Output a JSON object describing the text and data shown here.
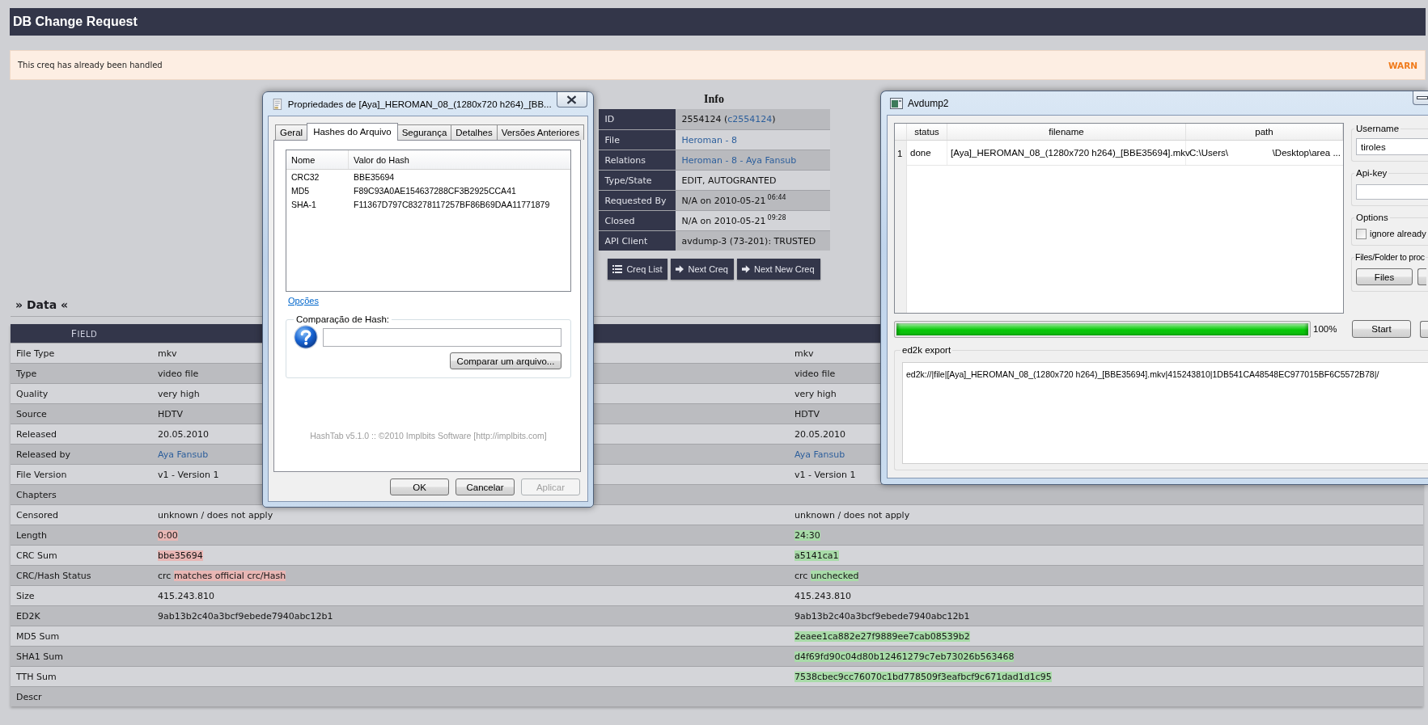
{
  "header": {
    "title": "DB Change Request"
  },
  "alert": {
    "message": "This creq has already been handled",
    "badge": "WARN"
  },
  "hash_dialog": {
    "title": "Propriedades de [Aya]_HEROMAN_08_(1280x720 h264)_[BB...",
    "tabs": [
      {
        "label": "Geral",
        "selected": false
      },
      {
        "label": "Hashes do Arquivo",
        "selected": true
      },
      {
        "label": "Segurança",
        "selected": false
      },
      {
        "label": "Detalhes",
        "selected": false
      },
      {
        "label": "Versões Anteriores",
        "selected": false
      }
    ],
    "hash_list": {
      "columns": [
        {
          "label": "Nome"
        },
        {
          "label": "Valor do Hash"
        }
      ],
      "rows": [
        {
          "name": "CRC32",
          "value": "BBE35694"
        },
        {
          "name": "MD5",
          "value": "F89C93A0AE154637288CF3B2925CCA41"
        },
        {
          "name": "SHA-1",
          "value": "F11367D797C83278117257BF86B69DAA11771879"
        }
      ]
    },
    "options_link": "Opções",
    "compare": {
      "legend": "Comparação de Hash:",
      "button": "Comparar um arquivo..."
    },
    "footer": "HashTab v5.1.0 :: ©2010 Implbits Software [http://implbits.com]",
    "buttons": [
      {
        "label": "OK",
        "disabled": false
      },
      {
        "label": "Cancelar",
        "disabled": false
      },
      {
        "label": "Aplicar",
        "disabled": true
      }
    ]
  },
  "info": {
    "title": "Info",
    "rows": [
      {
        "label": "ID",
        "value": [
          {
            "text": "2554124 (",
            "link": false
          },
          {
            "text": "c2554124",
            "link": true
          },
          {
            "text": ")",
            "link": false
          }
        ]
      },
      {
        "label": "File",
        "value": [
          {
            "text": "Heroman - 8",
            "link": true
          }
        ]
      },
      {
        "label": "Relations",
        "value": [
          {
            "text": "Heroman - 8 - Aya Fansub",
            "link": true
          }
        ]
      },
      {
        "label": "Type/State",
        "value": [
          {
            "text": "EDIT, AUTOGRANTED",
            "link": false
          }
        ]
      },
      {
        "label": "Requested By",
        "value": [
          {
            "text": "N/A on 2010-05-21$^{06:44}$",
            "link": false
          }
        ]
      },
      {
        "label": "Closed",
        "value": [
          {
            "text": "N/A on 2010-05-21$^{09:28}$",
            "link": false
          }
        ]
      },
      {
        "label": "API Client",
        "value": [
          {
            "text": "avdump-3 (73-201): TRUSTED",
            "link": false
          }
        ]
      }
    ],
    "buttons": [
      {
        "label": "Creq List",
        "kind": "list"
      },
      {
        "label": "Next Creq",
        "kind": "next"
      },
      {
        "label": "Next New Creq",
        "kind": "next"
      }
    ]
  },
  "avdump": {
    "title": "Avdump2",
    "table": {
      "columns": [
        {
          "label": "status"
        },
        {
          "label": "filename"
        },
        {
          "label": "path"
        }
      ],
      "rows": [
        {
          "number": "1",
          "status": "done",
          "filename": "[Aya]_HEROMAN_08_(1280x720 h264)_[BBE35694].mkv",
          "path": [
            "C:\\Users\\",
            "\\Desktop\\area ..."
          ]
        }
      ]
    },
    "username": {
      "label": "Username",
      "value": "tiroles"
    },
    "api_key": {
      "label": "Api-key"
    },
    "options": {
      "label": "Options",
      "checkboxes": [
        {
          "label": "ignore already",
          "checked": false
        }
      ]
    },
    "files": {
      "label": "Files/Folder to proc",
      "button": "Files"
    },
    "progress": {
      "level": 1,
      "reading": "100%"
    },
    "start_button": "Start",
    "ed2k_export": {
      "label": "ed2k export",
      "value": "ed2k://|file|[Aya]_HEROMAN_08_(1280x720 h264)_[BBE35694].mkv|415243810|1DB541CA48548EC977015BF6C5572B78|/"
    }
  },
  "data": {
    "heading": "» Data «",
    "columns": [
      {
        "label": "FIELD"
      }
    ],
    "rows": [
      {
        "field": "File Type",
        "column_2": [
          {
            "text": "mkv",
            "highlighted": false,
            "link": false
          }
        ],
        "column_3": [
          {
            "text": "mkv",
            "highlighted": false,
            "link": false
          }
        ]
      },
      {
        "field": "Type",
        "column_2": [
          {
            "text": "video file",
            "highlighted": false,
            "link": false
          }
        ],
        "column_3": [
          {
            "text": "video file",
            "highlighted": false,
            "link": false
          }
        ]
      },
      {
        "field": "Quality",
        "column_2": [
          {
            "text": "very high",
            "highlighted": false,
            "link": false
          }
        ],
        "column_3": [
          {
            "text": "very high",
            "highlighted": false,
            "link": false
          }
        ]
      },
      {
        "field": "Source",
        "column_2": [
          {
            "text": "HDTV",
            "highlighted": false,
            "link": false
          }
        ],
        "column_3": [
          {
            "text": "HDTV",
            "highlighted": false,
            "link": false
          }
        ]
      },
      {
        "field": "Released",
        "column_2": [
          {
            "text": "20.05.2010",
            "highlighted": false,
            "link": false
          }
        ],
        "column_3": [
          {
            "text": "20.05.2010",
            "highlighted": false,
            "link": false
          }
        ]
      },
      {
        "field": "Released by",
        "column_2": [
          {
            "text": "Aya Fansub",
            "highlighted": false,
            "link": true
          }
        ],
        "column_3": [
          {
            "text": "Aya Fansub",
            "highlighted": false,
            "link": true
          }
        ]
      },
      {
        "field": "File Version",
        "column_2": [
          {
            "text": "v1 - Version 1",
            "highlighted": false,
            "link": false
          }
        ],
        "column_3": [
          {
            "text": "v1 - Version 1",
            "highlighted": false,
            "link": false
          }
        ]
      },
      {
        "field": "Chapters"
      },
      {
        "field": "Censored",
        "column_2": [
          {
            "text": "unknown / does not apply",
            "highlighted": false,
            "link": false
          }
        ],
        "column_3": [
          {
            "text": "unknown / does not apply",
            "highlighted": false,
            "link": false
          }
        ]
      },
      {
        "field": "Length",
        "column_2": [
          {
            "text": "0:00",
            "highlighted": true,
            "link": false
          }
        ],
        "column_3": [
          {
            "text": "24:30",
            "highlighted": true,
            "link": false
          }
        ]
      },
      {
        "field": "CRC Sum",
        "column_2": [
          {
            "text": "bbe35694",
            "highlighted": true,
            "link": false
          }
        ],
        "column_3": [
          {
            "text": "a5141ca1",
            "highlighted": true,
            "link": false
          }
        ]
      },
      {
        "field": "CRC/Hash Status",
        "column_2": [
          {
            "text": "crc ",
            "highlighted": false,
            "link": false
          },
          {
            "text": "matches official crc/Hash",
            "highlighted": true,
            "link": false
          }
        ],
        "column_3": [
          {
            "text": "crc ",
            "highlighted": false,
            "link": false
          },
          {
            "text": "unchecked",
            "highlighted": true,
            "link": false
          }
        ]
      },
      {
        "field": "Size",
        "column_2": [
          {
            "text": "415.243.810",
            "highlighted": false,
            "link": false
          }
        ],
        "column_3": [
          {
            "text": "415.243.810",
            "highlighted": false,
            "link": false
          }
        ]
      },
      {
        "field": "ED2K",
        "column_2": [
          {
            "text": "9ab13b2c40a3bcf9ebede7940abc12b1",
            "highlighted": false,
            "link": false
          }
        ],
        "column_3": [
          {
            "text": "9ab13b2c40a3bcf9ebede7940abc12b1",
            "highlighted": false,
            "link": false
          }
        ]
      },
      {
        "field": "MD5 Sum",
        "column_3": [
          {
            "text": "2eaee1ca882e27f9889ee7cab08539b2",
            "highlighted": true,
            "link": false
          }
        ]
      },
      {
        "field": "SHA1 Sum",
        "column_3": [
          {
            "text": "d4f69fd90c04d80b12461279c7eb73026b563468",
            "highlighted": true,
            "link": false
          }
        ]
      },
      {
        "field": "TTH Sum",
        "column_3": [
          {
            "text": "7538cbec9cc76070c1bd778509f3eafbcf9c671dad1d1c95",
            "highlighted": true,
            "link": false
          }
        ]
      },
      {
        "field": "Descr"
      }
    ]
  }
}
